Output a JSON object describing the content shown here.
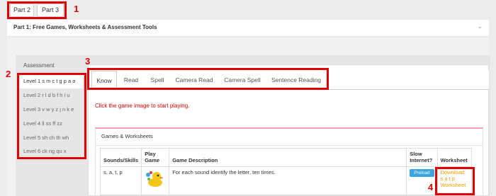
{
  "part_tabs": [
    "Part 2",
    "Part 3"
  ],
  "accordion": {
    "title": "Part 1: Free Games, Worksheets & Assessment Tools",
    "chevron_icon": "chevron-down-icon"
  },
  "levels": {
    "heading": "Assessment",
    "items": [
      "Level 1 s m c t g p a o",
      "Level 2 r l d b f h i u",
      "Level 3 v w y z j n k e",
      "Level 4 ll ss ff zz",
      "Level 5 sh ch th wh",
      "Level 6 ck ng qu x"
    ]
  },
  "tabs": [
    "Know",
    "Read",
    "Spell",
    "Camera Read",
    "Camera Spell",
    "Sentence Reading"
  ],
  "instruction": "Click the game image to start playing.",
  "games": {
    "title": "Games & Worksheets",
    "columns": [
      "Sounds/Skills",
      "Play Game",
      "Game Description",
      "Slow Internet?",
      "Worksheet"
    ],
    "rows": [
      {
        "sounds": "s, a, t, p",
        "game_icon": "duck-game-icon",
        "description": "For each sound identify the letter, ten times.",
        "preload": "Preload",
        "worksheet": "Download: s a t p Worksheet"
      }
    ]
  },
  "annotations": [
    "1",
    "2",
    "3",
    "4"
  ],
  "colors": {
    "annotation": "#e00000",
    "preload": "#3aa6e0",
    "download": "#f29a00",
    "instruction": "#e00000"
  }
}
